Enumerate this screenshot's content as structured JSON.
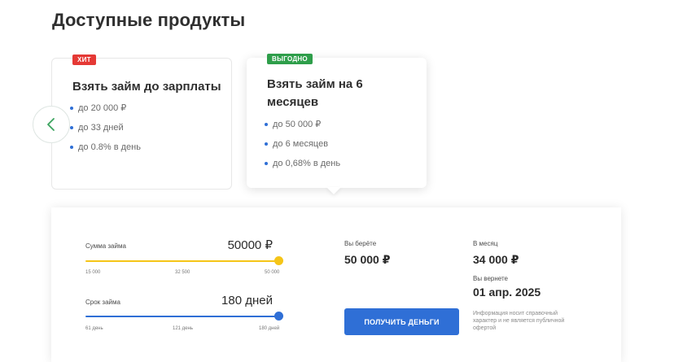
{
  "page": {
    "title": "Доступные продукты"
  },
  "colors": {
    "accent_blue": "#2f6fd6",
    "slider_yellow": "#f5c518",
    "badge_hit": "#e53935",
    "badge_profitable": "#2e9e4a",
    "arrow_green": "#3aa35d"
  },
  "carousel": {
    "prev_icon": "chevron-left-icon",
    "products": [
      {
        "badge": "ХИТ",
        "title": "Взять займ до зарплаты",
        "features": [
          "до 20 000 ₽",
          "до 33 дней",
          "до 0.8% в день"
        ]
      },
      {
        "badge": "ВЫГОДНО",
        "title": "Взять займ на 6 месяцев",
        "features": [
          "до 50 000 ₽",
          "до 6 месяцев",
          "до 0,68% в день"
        ]
      }
    ]
  },
  "calculator": {
    "amount": {
      "label": "Сумма займа",
      "value": "50000 ₽",
      "ticks": [
        "15 000",
        "32 500",
        "50 000"
      ],
      "fraction": 1.0
    },
    "term": {
      "label": "Срок займа",
      "value": "180 дней",
      "ticks": [
        "61 день",
        "121 день",
        "180 дней"
      ],
      "fraction": 1.0
    },
    "take": {
      "label": "Вы берёте",
      "value": "50 000 ₽"
    },
    "monthly": {
      "label": "В месяц",
      "value": "34 000 ₽"
    },
    "return": {
      "label": "Вы вернете",
      "value": "01 апр. 2025"
    },
    "cta": "ПОЛУЧИТЬ ДЕНЬГИ",
    "disclaimer": "Информация носит справочный характер и не является публичной офертой"
  }
}
